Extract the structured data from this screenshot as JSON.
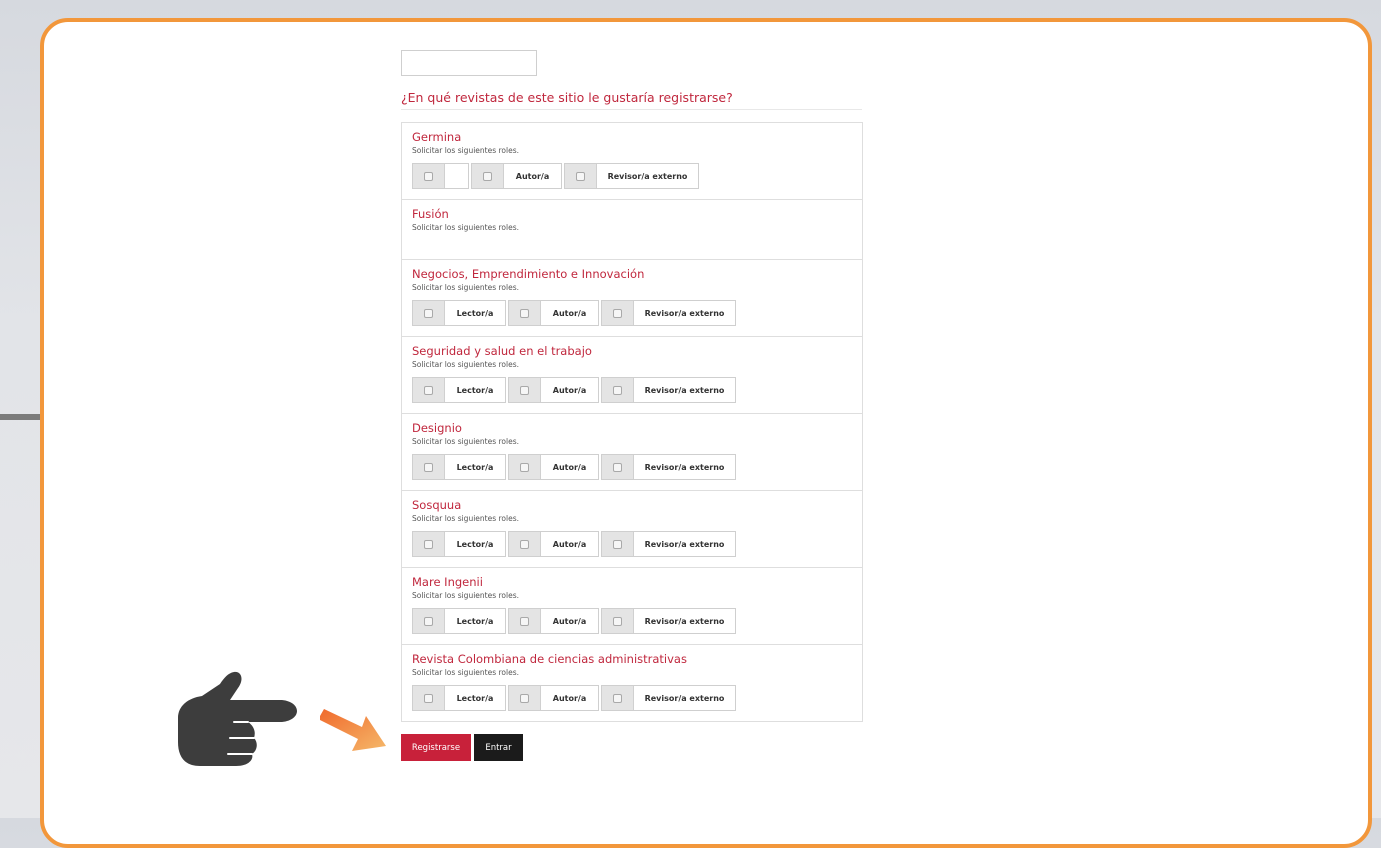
{
  "question": "¿En qué revistas de este sitio le gustaría registrarse?",
  "role_request_text": "Solicitar los siguientes roles.",
  "journals": [
    {
      "name": "Germina",
      "roles": [
        "",
        "Autor/a",
        "Revisor/a externo"
      ]
    },
    {
      "name": "Fusión",
      "roles": []
    },
    {
      "name": "Negocios, Emprendimiento e Innovación",
      "roles": [
        "Lector/a",
        "Autor/a",
        "Revisor/a externo"
      ]
    },
    {
      "name": "Seguridad y salud en el trabajo",
      "roles": [
        "Lector/a",
        "Autor/a",
        "Revisor/a externo"
      ]
    },
    {
      "name": "Designio",
      "roles": [
        "Lector/a",
        "Autor/a",
        "Revisor/a externo"
      ]
    },
    {
      "name": "Sosquua",
      "roles": [
        "Lector/a",
        "Autor/a",
        "Revisor/a externo"
      ]
    },
    {
      "name": "Mare Ingenii",
      "roles": [
        "Lector/a",
        "Autor/a",
        "Revisor/a externo"
      ]
    },
    {
      "name": "Revista Colombiana de ciencias administrativas",
      "roles": [
        "Lector/a",
        "Autor/a",
        "Revisor/a externo"
      ]
    }
  ],
  "buttons": {
    "register": "Registrarse",
    "login": "Entrar"
  },
  "colors": {
    "accent": "#c0273d",
    "frame": "#f2973b",
    "login_button": "#1b1b1b"
  },
  "icons": {
    "hand": "pointing-hand-icon",
    "arrow": "arrow-icon"
  }
}
